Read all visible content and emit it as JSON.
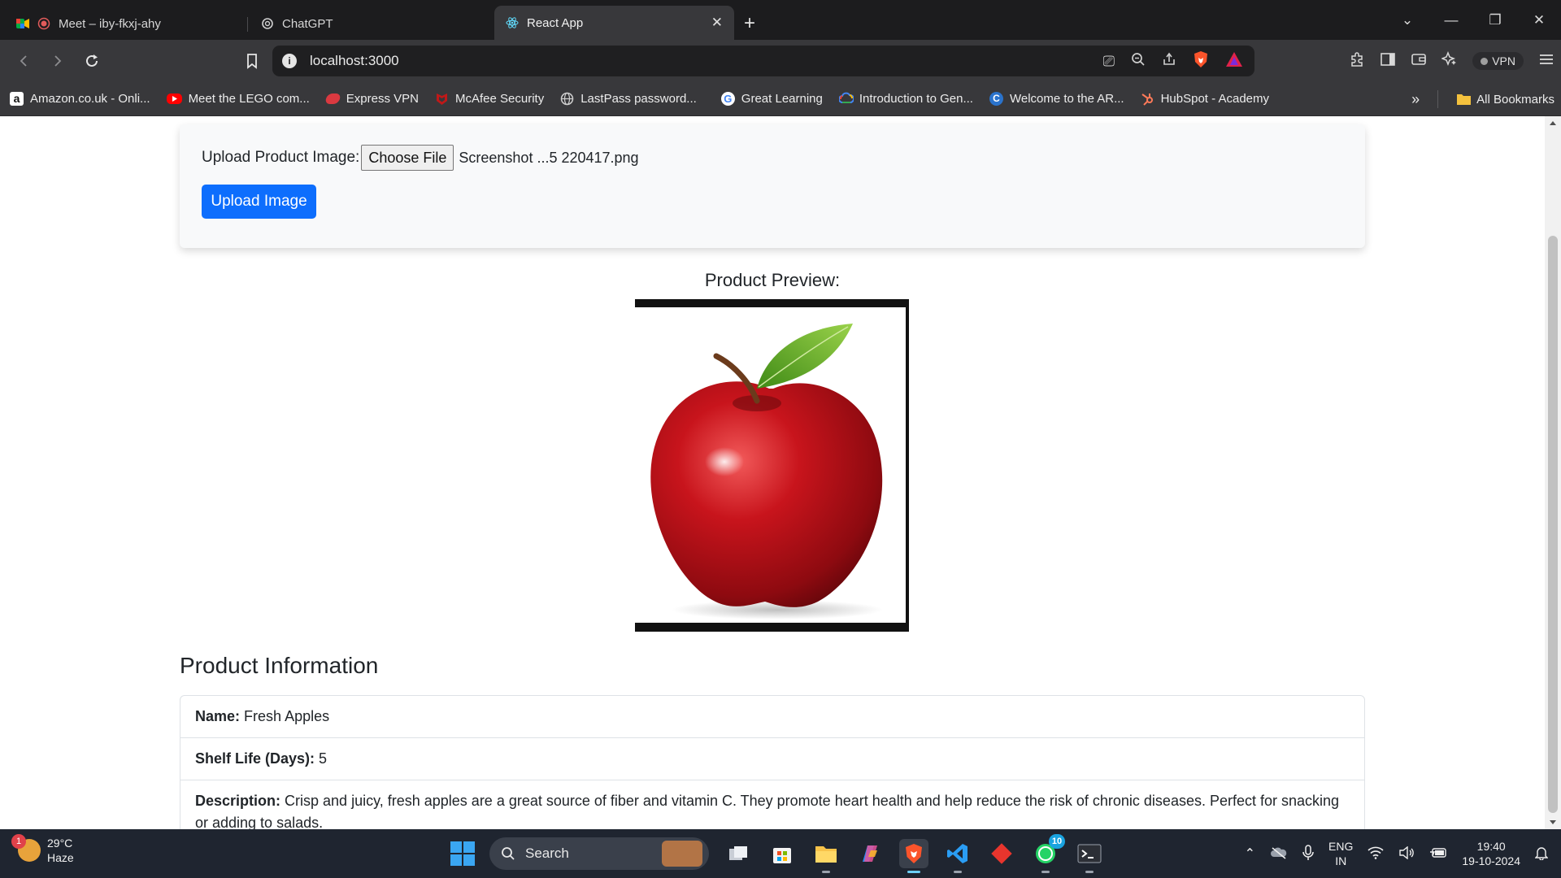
{
  "browser": {
    "tabs": [
      {
        "title": "Meet – iby-fkxj-ahy",
        "active": false
      },
      {
        "title": "ChatGPT",
        "active": false
      },
      {
        "title": "React App",
        "active": true
      }
    ],
    "new_tab_symbol": "+",
    "address": "localhost:3000",
    "vpn_label": "VPN",
    "bookmarks": [
      {
        "label": "Amazon.co.uk - Onli...",
        "icon": "amazon-icon",
        "color": "#ffffff"
      },
      {
        "label": "Meet the LEGO com...",
        "icon": "youtube-icon",
        "color": "#ff0000"
      },
      {
        "label": "Express VPN",
        "icon": "expressvpn-icon",
        "color": "#da3940"
      },
      {
        "label": "McAfee Security",
        "icon": "mcafee-icon",
        "color": "#c01818"
      },
      {
        "label": "LastPass password...",
        "icon": "globe-icon",
        "color": "#bdbdbd"
      },
      {
        "label": "Great Learning",
        "icon": "google-icon",
        "color": "#ffffff"
      },
      {
        "label": "Introduction to Gen...",
        "icon": "google-cloud-icon",
        "color": "#4285f4"
      },
      {
        "label": "Welcome to the AR...",
        "icon": "coursera-icon",
        "color": "#2a73cc"
      },
      {
        "label": "HubSpot - Academy",
        "icon": "hubspot-icon",
        "color": "#ff7a59"
      }
    ],
    "all_bookmarks_label": "All Bookmarks"
  },
  "page": {
    "upload_label": "Upload Product Image:",
    "choose_file_label": "Choose File",
    "file_name": "Screenshot ...5 220417.png",
    "upload_button_label": "Upload Image",
    "preview_title": "Product Preview:",
    "info_title": "Product Information",
    "info": [
      {
        "label": "Name:",
        "value": "Fresh Apples"
      },
      {
        "label": "Shelf Life (Days):",
        "value": "5"
      },
      {
        "label": "Description:",
        "value": "Crisp and juicy, fresh apples are a great source of fiber and vitamin C. They promote heart health and help reduce the risk of chronic diseases. Perfect for snacking or adding to salads."
      }
    ]
  },
  "taskbar": {
    "weather_temp": "29°C",
    "weather_desc": "Haze",
    "weather_badge": "1",
    "search_placeholder": "Search",
    "whatsapp_count": "10",
    "lang_top": "ENG",
    "lang_bottom": "IN",
    "time": "19:40",
    "date": "19-10-2024"
  },
  "colors": {
    "accent": "#0d6efd",
    "tab_bar": "#1c1c1e",
    "toolbar": "#38383b",
    "taskbar": "#1f2530"
  }
}
